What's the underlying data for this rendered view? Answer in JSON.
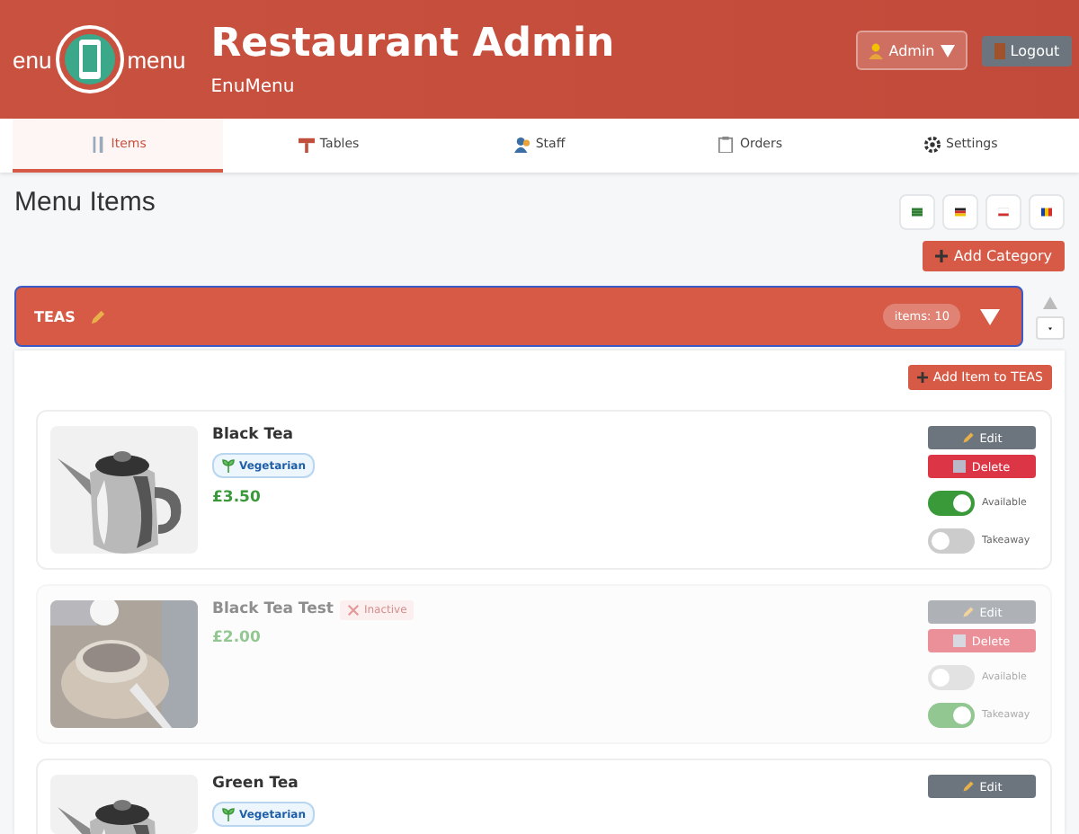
{
  "header": {
    "logo_left": "enu",
    "logo_right": "menu",
    "title": "Restaurant Admin",
    "subtitle": "EnuMenu",
    "user_button": "Admin",
    "logout_button": "Logout"
  },
  "tabs": [
    {
      "label": "Items",
      "selected": true
    },
    {
      "label": "Tables",
      "selected": false
    },
    {
      "label": "Staff",
      "selected": false
    },
    {
      "label": "Orders",
      "selected": false
    },
    {
      "label": "Settings",
      "selected": false
    }
  ],
  "page_title": "Menu Items",
  "add_category_button": "Add Category",
  "category": {
    "name": "TEAS",
    "count": "items: 10",
    "expanded": true,
    "add_item_button": "Add Item to TEAS",
    "items": [
      {
        "name": "Black Tea",
        "kind": "teapot",
        "active": true,
        "badges": [
          {
            "kind": "vegetarian",
            "label": "Vegetarian"
          }
        ],
        "price": "£3.50",
        "edit": "Edit",
        "delete": "Delete",
        "toggles": [
          {
            "label": "Available",
            "on": true
          },
          {
            "label": "Takeaway",
            "on": false
          }
        ]
      },
      {
        "name": "Black Tea Test",
        "kind": "cup",
        "active": false,
        "badges": [
          {
            "kind": "inactive",
            "label": "Inactive"
          }
        ],
        "price": "£2.00",
        "edit": "Edit",
        "delete": "Delete",
        "toggles": [
          {
            "label": "Available",
            "on": false
          },
          {
            "label": "Takeaway",
            "on": true
          }
        ]
      },
      {
        "name": "Green Tea",
        "kind": "teapot",
        "active": true,
        "badges": [
          {
            "kind": "vegetarian",
            "label": "Vegetarian"
          }
        ],
        "edit": "Edit"
      }
    ]
  }
}
